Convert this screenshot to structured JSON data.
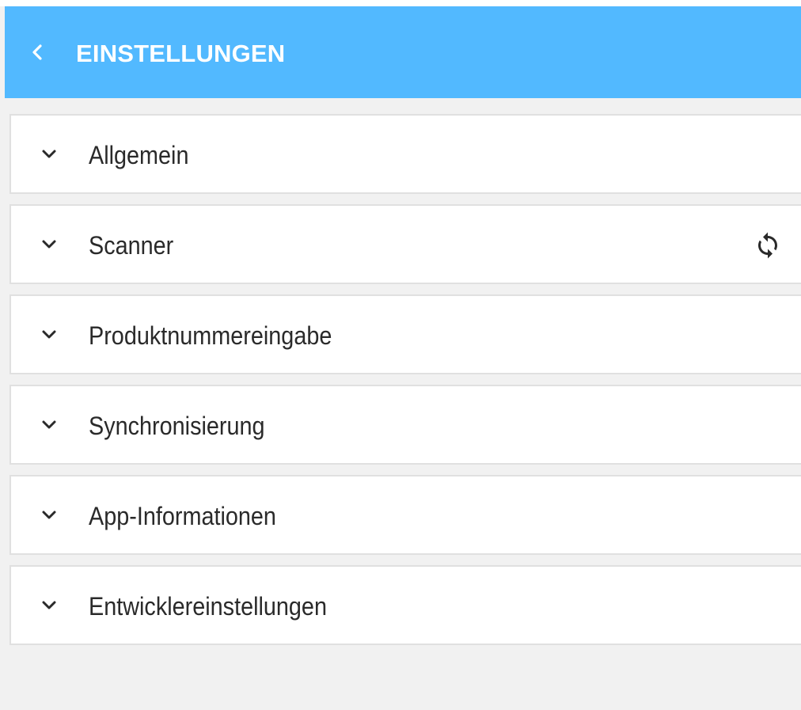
{
  "header": {
    "title": "EINSTELLUNGEN",
    "back_icon": "chevron-left-icon",
    "background_color": "#52b9ff"
  },
  "sections": [
    {
      "label": "Allgemein",
      "icon": "chevron-down-icon"
    },
    {
      "label": "Scanner",
      "icon": "chevron-down-icon",
      "action_icon": "refresh-icon"
    },
    {
      "label": "Produktnummereingabe",
      "icon": "chevron-down-icon"
    },
    {
      "label": "Synchronisierung",
      "icon": "chevron-down-icon"
    },
    {
      "label": "App-Informationen",
      "icon": "chevron-down-icon"
    },
    {
      "label": "Entwicklereinstellungen",
      "icon": "chevron-down-icon"
    }
  ],
  "colors": {
    "page_background": "#f1f1f1",
    "card_background": "#ffffff",
    "card_border": "#e0e0e0",
    "text": "#2a2a2a"
  }
}
